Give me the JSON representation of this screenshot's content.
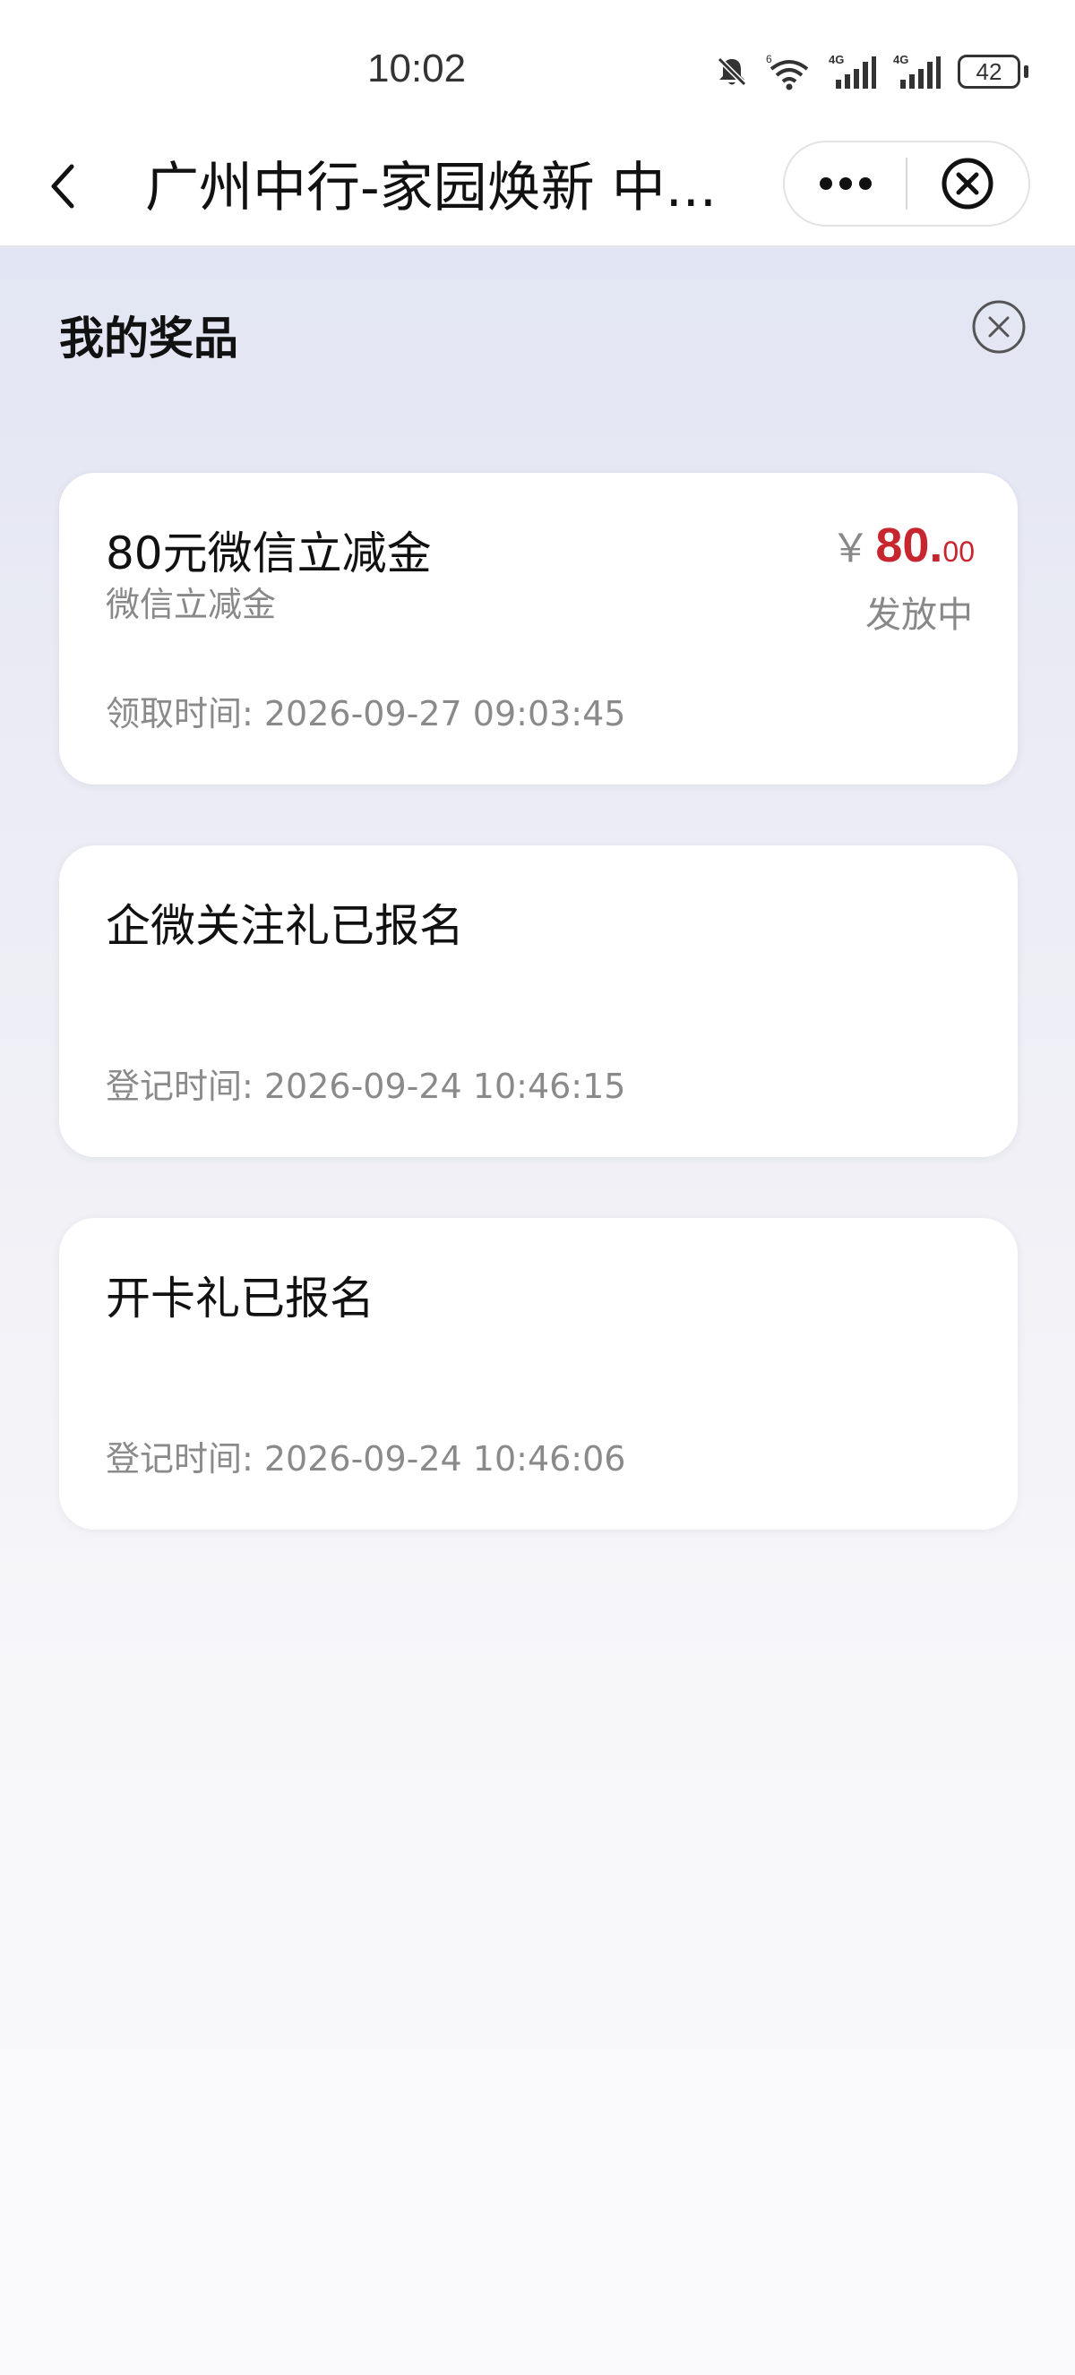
{
  "status_bar": {
    "time": "10:02",
    "battery": "42",
    "network_labels": [
      "6",
      "4G",
      "4G"
    ]
  },
  "nav": {
    "title": "广州中行-家园焕新 中..."
  },
  "page": {
    "title": "我的奖品"
  },
  "prizes": [
    {
      "title": "80元微信立减金",
      "subtitle": "微信立减金",
      "price_symbol": "￥",
      "price_integer": "80.",
      "price_decimal": "00",
      "status": "发放中",
      "time": "领取时间: 2026-09-27 09:03:45"
    },
    {
      "title": "企微关注礼已报名",
      "time": "登记时间: 2026-09-24 10:46:15"
    },
    {
      "title": "开卡礼已报名",
      "time": "登记时间: 2026-09-24 10:46:06"
    }
  ],
  "colors": {
    "price_red": "#c8262e",
    "text_primary": "#111111",
    "text_secondary": "#888888",
    "background_top": "#e2e5f3",
    "card_background": "#ffffff"
  },
  "icons": {
    "back": "chevron-left-icon",
    "more": "more-dots-icon",
    "close_mini_program": "close-circle-icon",
    "close_panel": "close-circle-icon",
    "mute": "bell-off-icon",
    "wifi": "wifi-icon",
    "signal": "signal-bars-icon",
    "battery": "battery-icon"
  }
}
